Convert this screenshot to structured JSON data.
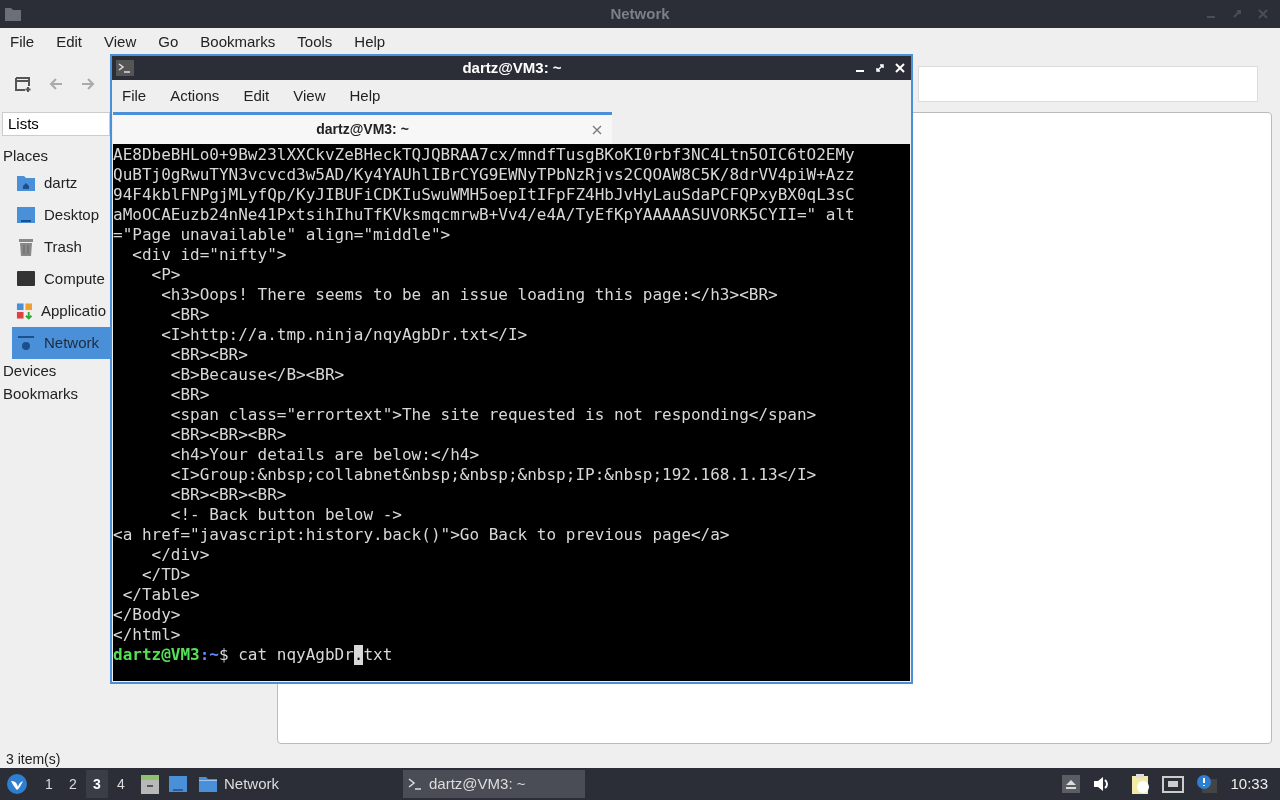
{
  "file_manager": {
    "title": "Network",
    "menu": [
      "File",
      "Edit",
      "View",
      "Go",
      "Bookmarks",
      "Tools",
      "Help"
    ],
    "side_panel": {
      "mode": "Lists",
      "sections": [
        {
          "label": "Places",
          "items": [
            {
              "label": "dartz",
              "selected": false
            },
            {
              "label": "Desktop",
              "selected": false
            },
            {
              "label": "Trash",
              "selected": false
            },
            {
              "label": "Compute",
              "selected": false
            },
            {
              "label": "Applicatio",
              "selected": false
            },
            {
              "label": "Network",
              "selected": true
            }
          ]
        },
        {
          "label": "Devices"
        },
        {
          "label": "Bookmarks"
        }
      ]
    },
    "status_bar": "3 item(s)"
  },
  "terminal": {
    "title": "dartz@VM3: ~",
    "menu": [
      "File",
      "Actions",
      "Edit",
      "View",
      "Help"
    ],
    "tab": "dartz@VM3: ~",
    "lines": [
      "AE8DbeBHLo0+9Bw23lXXCkvZeBHeckTQJQBRAA7cx/mndfTusgBKoKI0rbf3NC4Ltn5OIC6tO2EMy",
      "QuBTj0gRwuTYN3vcvcd3w5AD/Ky4YAUhlIBrCYG9EWNyTPbNzRjvs2CQOAW8C5K/8drVV4piW+Azz",
      "94F4kblFNPgjMLyfQp/KyJIBUFiCDKIuSwuWMH5oepItIFpFZ4HbJvHyLauSdaPCFQPxyBX0qL3sC",
      "aMoOCAEuzb24nNe41PxtsihIhuTfKVksmqcmrwB+Vv4/e4A/TyEfKpYAAAAASUVORK5CYII=\" alt",
      "=\"Page unavailable\" align=\"middle\">",
      "  <div id=\"nifty\">",
      "    <P>",
      "     <h3>Oops! There seems to be an issue loading this page:</h3><BR>",
      "      <BR>",
      "     <I>http://a.tmp.ninja/nqyAgbDr.txt</I>",
      "      <BR><BR>",
      "      <B>Because</B><BR>",
      "      <BR>",
      "      <span class=\"errortext\">The site requested is not responding</span>",
      "      <BR><BR><BR>",
      "      <h4>Your details are below:</h4>",
      "      <I>Group:&nbsp;collabnet&nbsp;&nbsp;&nbsp;IP:&nbsp;192.168.1.13</I>",
      "      <BR><BR><BR>",
      "      <!- Back button below ->",
      "<a href=\"javascript:history.back()\">Go Back to previous page</a>",
      "    </div>",
      "   </TD>",
      " </Table>",
      "</Body>",
      "</html>"
    ],
    "prompt": {
      "user_host": "dartz@VM3",
      "path": ":~",
      "command_before": "$ cat nqyAgbDr",
      "cursor_char": ".",
      "command_after": "txt"
    }
  },
  "taskbar": {
    "workspaces": [
      {
        "label": "1",
        "selected": false
      },
      {
        "label": "2",
        "selected": false
      },
      {
        "label": "3",
        "selected": true
      },
      {
        "label": "4",
        "selected": false
      }
    ],
    "tasks": [
      {
        "label": "Network",
        "selected": false
      },
      {
        "label": "dartz@VM3: ~",
        "selected": true
      }
    ],
    "clock": "10:33"
  }
}
